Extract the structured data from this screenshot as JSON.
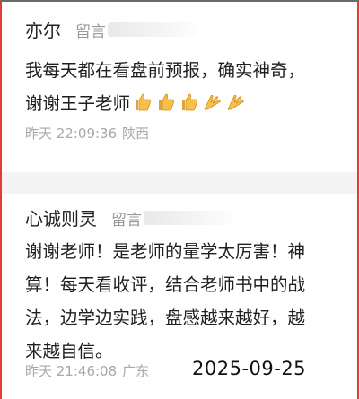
{
  "comments": [
    {
      "name": "亦尔",
      "tag": "留言",
      "text_line1": "我每天都在看盘前预报，确实神奇，",
      "text_line2": "谢谢王子老师",
      "emojis": [
        "thumbs-up-icon",
        "thumbs-up-icon",
        "thumbs-up-icon",
        "clap-hands-icon",
        "clap-hands-icon"
      ],
      "time": "昨天 22:09:36",
      "location": "陕西"
    },
    {
      "name": "心诚则灵",
      "tag": "留言",
      "text_lines": [
        "谢谢老师！是老师的量学太厉害！神",
        "算！每天看收评，结合老师书中的战",
        "法，边学边实践，盘感越来越好，越",
        "来越自信。"
      ],
      "time": "昨天 21:46:08",
      "location": "广东"
    }
  ],
  "date_stamp": "2025-09-25",
  "colors": {
    "frame_border": "#e23b3b",
    "divider": "#f4f4f4",
    "meta_text": "#a8a8a8",
    "tag_text": "#9a9a9a"
  }
}
